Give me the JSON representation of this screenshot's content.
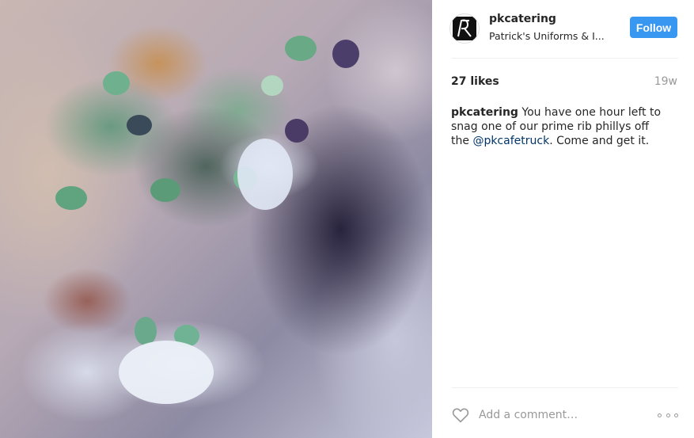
{
  "post": {
    "image_alt": "",
    "author": {
      "username": "pkcatering",
      "location": "Patrick's Uniforms & I...",
      "avatar_icon": "pk-monogram-logo"
    },
    "follow_label": "Follow",
    "likes_text": "27 likes",
    "age": "19w",
    "caption": {
      "author": "pkcatering",
      "text_before": "You have one hour left to snag one of our prime rib phillys off the",
      "mention": "@pkcafetruck",
      "text_after": ". Come and get it."
    },
    "comment_placeholder": "Add a comment…",
    "colors": {
      "follow_button": "#3897f0",
      "mention_link": "#003569",
      "muted_text": "#999999"
    }
  }
}
